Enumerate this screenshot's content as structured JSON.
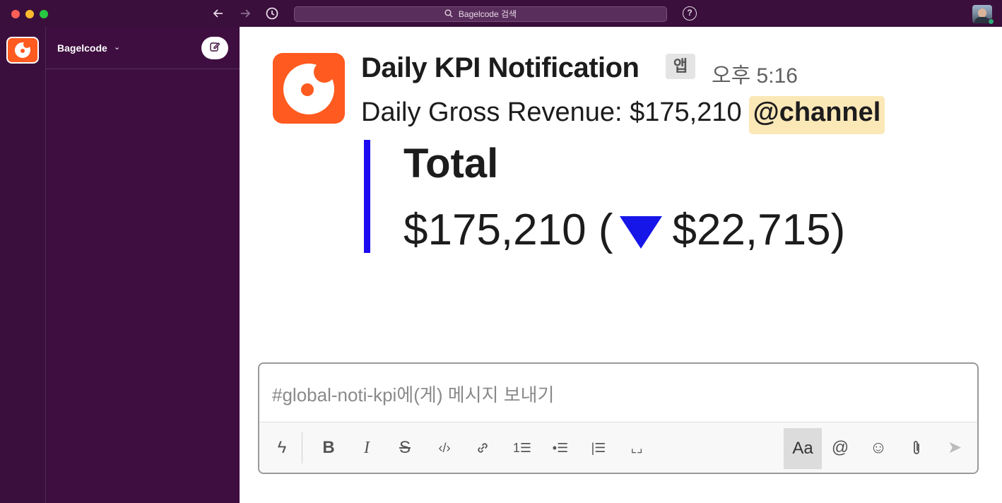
{
  "titlebar": {
    "search_placeholder": "Bagelcode 검색",
    "back_icon": "arrow-left-icon",
    "forward_icon": "arrow-right-icon",
    "history_icon": "clock-icon",
    "help_icon": "question-circle-icon",
    "help_glyph": "?"
  },
  "sidebar": {
    "workspace_name": "Bagelcode",
    "workspace_chevron": "⌄",
    "compose_icon": "compose-icon"
  },
  "message": {
    "sender": "Daily KPI Notification",
    "app_badge": "앱",
    "time": "오후 5:16",
    "text": "Daily Gross Revenue: $175,210",
    "mention": "@channel",
    "attachment": {
      "title": "Total",
      "value_prefix": "$175,210 (",
      "value_suffix": "$22,715)",
      "trend_icon": "down-triangle-icon",
      "bar_color": "#1c0af0",
      "trend_color": "#1616e8"
    }
  },
  "composer": {
    "placeholder": "#global-noti-kpi에(게) 메시지 보내기",
    "toolbar": {
      "shortcuts": "ϟ",
      "bold": "B",
      "italic": "I",
      "strike": "S",
      "code": "‹/›",
      "link": "🔗",
      "ordered_list": "1☰",
      "bullet_list": "•☰",
      "blockquote": "|☰",
      "code_block": "⌞⌟",
      "format": "Aa",
      "mention": "@",
      "emoji": "☺",
      "attach": "📎",
      "send": "➤"
    }
  },
  "colors": {
    "titlebar": "#3a0f3c",
    "sidebar": "#3f0e40",
    "bagelcode_orange": "#ff5a1f",
    "mention_bg": "#fbe8b7"
  }
}
